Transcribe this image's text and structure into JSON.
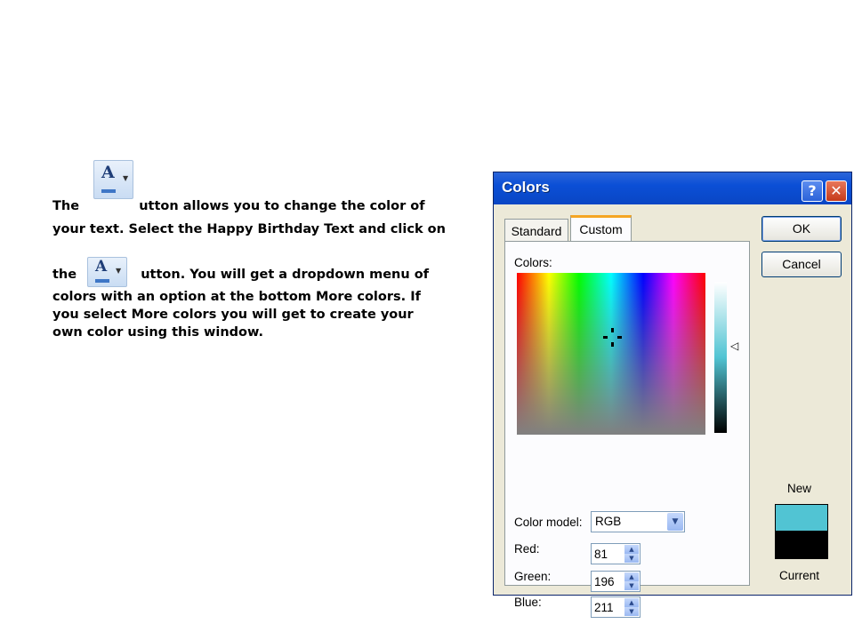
{
  "instructions": {
    "line1_prefix": "The",
    "line1_suffix": "utton allows you to change the color of",
    "line2": "your text. Select the Happy Birthday Text and click on",
    "line3_prefix": "the",
    "line3_suffix": "utton. You will get a dropdown menu of",
    "line4": "colors with an option at the bottom More colors. If",
    "line5": "you select More colors you will get to create your",
    "line6": "own color using this window.",
    "icon_letter": "A"
  },
  "dialog": {
    "title": "Colors",
    "help_label": "?",
    "close_label": "✕",
    "tabs": [
      {
        "label": "Standard",
        "active": false
      },
      {
        "label": "Custom",
        "active": true
      }
    ],
    "colors_label": "Colors:",
    "color_model_label": "Color model:",
    "color_model_value": "RGB",
    "red_label": "Red:",
    "red_value": "81",
    "green_label": "Green:",
    "green_value": "196",
    "blue_label": "Blue:",
    "blue_value": "211",
    "ok_label": "OK",
    "cancel_label": "Cancel",
    "new_label": "New",
    "current_label": "Current",
    "new_color": "#51c4d3",
    "current_color": "#000000"
  }
}
